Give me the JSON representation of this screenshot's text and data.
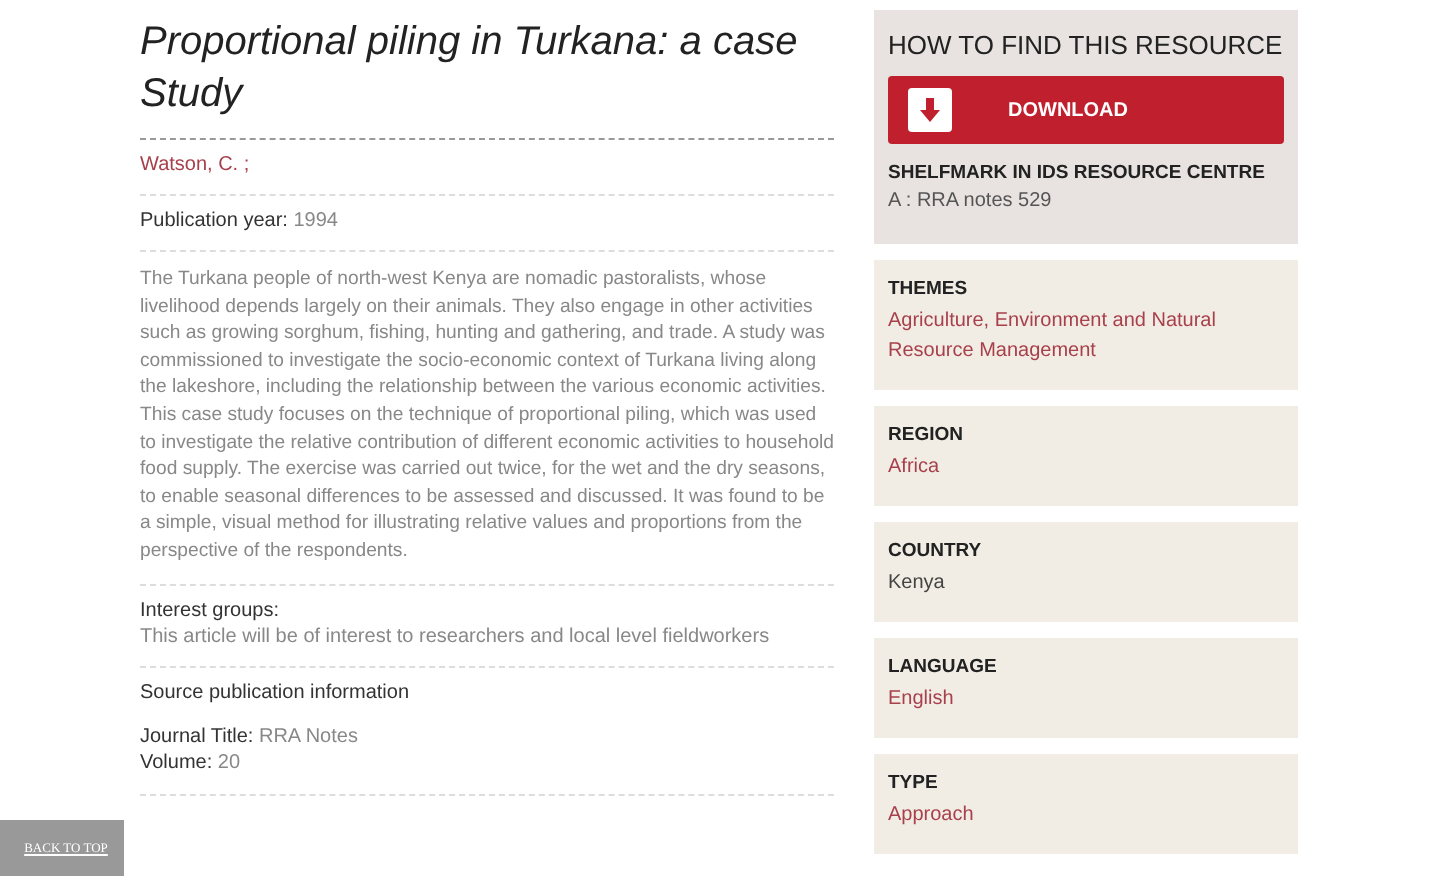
{
  "title": "Proportional piling in Turkana: a case Study",
  "author": "Watson, C. ;",
  "publication_year": {
    "label": "Publication year:",
    "value": "1994"
  },
  "abstract": "The Turkana people of north-west Kenya are nomadic pastoralists, whose livelihood depends largely on their animals. They also engage in other activities such as growing sorghum, fishing, hunting and gathering, and trade. A study was commissioned to investigate the socio-economic context of Turkana living along the lakeshore, including the relationship between the various economic activities. This case study focuses on the technique of proportional piling, which was used to investigate the relative contribution of different economic activities to household food supply. The exercise was carried out twice, for the wet and the dry seasons, to enable seasonal differences to be assessed and discussed. It was found to be a simple, visual method for illustrating relative values and proportions from the perspective of the respondents.",
  "interest_groups": {
    "label": "Interest groups:",
    "value": "This article will be of interest to researchers and local level fieldworkers"
  },
  "source": {
    "heading": "Source publication information",
    "fields": [
      {
        "label": "Journal Title:",
        "value": "RRA Notes"
      },
      {
        "label": "Volume:",
        "value": "20"
      }
    ]
  },
  "back_to_top": "BACK TO TOP",
  "find_resource": {
    "heading": "HOW TO FIND THIS RESOURCE",
    "download": "DOWNLOAD",
    "shelfmark_label": "SHELFMARK IN IDS RESOURCE CENTRE",
    "shelfmark": "A : RRA notes 529"
  },
  "facets": [
    {
      "heading": "THEMES",
      "kind": "link",
      "value": "Agriculture, Environment and Natural Resource Management"
    },
    {
      "heading": "REGION",
      "kind": "link",
      "value": "Africa"
    },
    {
      "heading": "COUNTRY",
      "kind": "text",
      "value": "Kenya"
    },
    {
      "heading": "LANGUAGE",
      "kind": "link",
      "value": "English"
    },
    {
      "heading": "TYPE",
      "kind": "link",
      "value": "Approach"
    }
  ]
}
